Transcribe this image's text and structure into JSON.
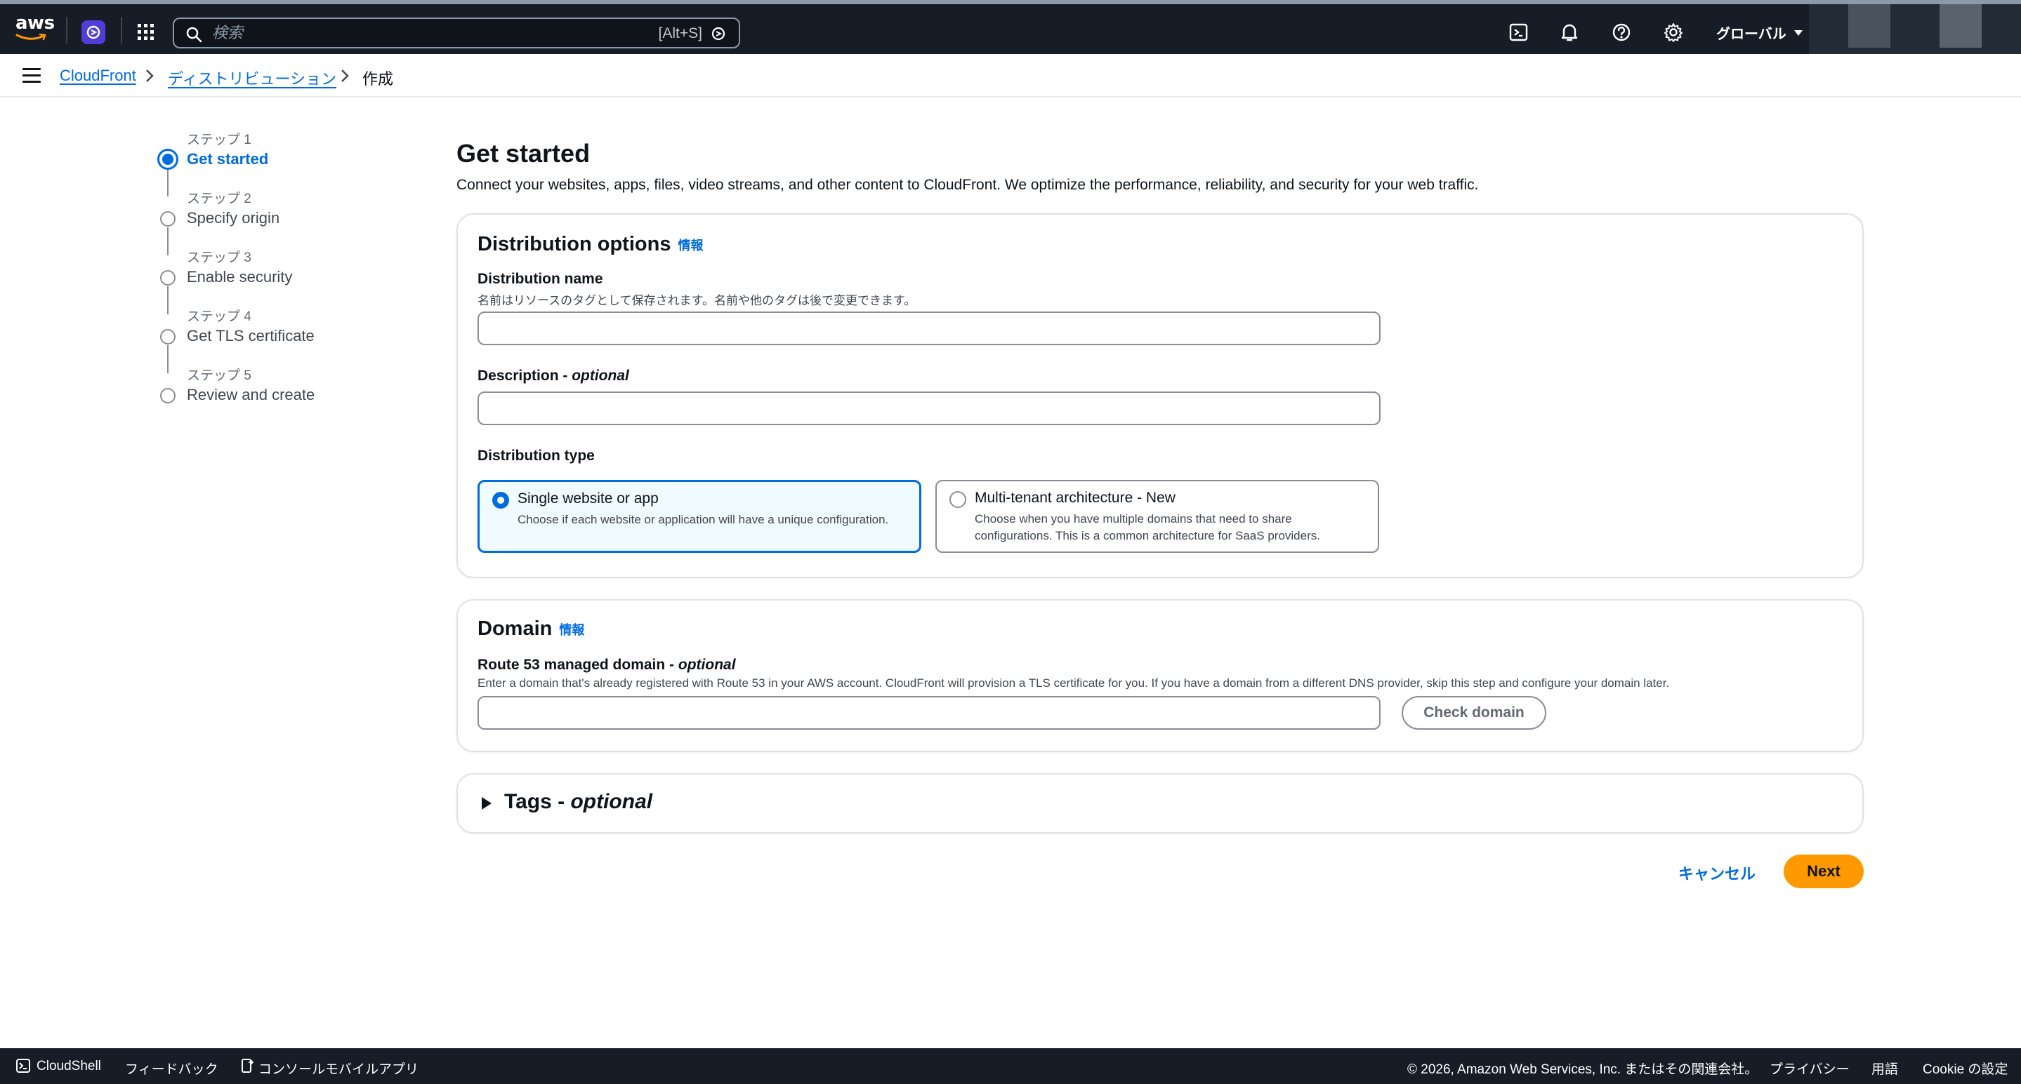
{
  "topnav": {
    "logo_text": "aws",
    "search_placeholder": "検索",
    "search_shortcut": "[Alt+S]",
    "region_label": "グローバル",
    "icons": [
      "cloudshell-icon",
      "bell-icon",
      "help-icon",
      "gear-icon"
    ]
  },
  "breadcrumb": {
    "items": [
      "CloudFront",
      "ディストリビューション",
      "作成"
    ]
  },
  "steps": [
    {
      "num": "ステップ 1",
      "label": "Get started",
      "active": true
    },
    {
      "num": "ステップ 2",
      "label": "Specify origin",
      "active": false
    },
    {
      "num": "ステップ 3",
      "label": "Enable security",
      "active": false
    },
    {
      "num": "ステップ 4",
      "label": "Get TLS certificate",
      "active": false
    },
    {
      "num": "ステップ 5",
      "label": "Review and create",
      "active": false
    }
  ],
  "page": {
    "title": "Get started",
    "description": "Connect your websites, apps, files, video streams, and other content to CloudFront. We optimize the performance, reliability, and security for your web traffic."
  },
  "distribution_options": {
    "title": "Distribution options",
    "info": "情報",
    "name_label": "Distribution name",
    "name_hint": "名前はリソースのタグとして保存されます。名前や他のタグは後で変更できます。",
    "name_value": "",
    "desc_label": "Description - ",
    "desc_label_optional": "optional",
    "desc_value": "",
    "type_label": "Distribution type",
    "type_single_title": "Single website or app",
    "type_single_desc": "Choose if each website or application will have a unique configuration.",
    "type_multi_title": "Multi-tenant architecture - New",
    "type_multi_desc": "Choose when you have multiple domains that need to share configurations. This is a common architecture for SaaS providers.",
    "selected": "single"
  },
  "domain": {
    "title": "Domain",
    "info": "情報",
    "label": "Route 53 managed domain - ",
    "label_optional": "optional",
    "hint": "Enter a domain that's already registered with Route 53 in your AWS account. CloudFront will provision a TLS certificate for you. If you have a domain from a different DNS provider, skip this step and configure your domain later.",
    "value": "",
    "check_button": "Check domain"
  },
  "tags": {
    "title": "Tags - ",
    "title_optional": "optional"
  },
  "actions": {
    "cancel": "キャンセル",
    "next": "Next"
  },
  "footer": {
    "cloudshell": "CloudShell",
    "feedback": "フィードバック",
    "mobile_app": "コンソールモバイルアプリ",
    "copyright": "© 2026, Amazon Web Services, Inc. またはその関連会社。",
    "privacy": "プライバシー",
    "terms": "用語",
    "cookie": "Cookie の設定"
  }
}
